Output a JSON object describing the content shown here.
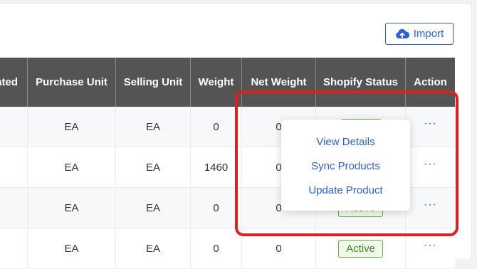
{
  "import_button": {
    "label": "Import",
    "icon": "cloud-upload-icon"
  },
  "table": {
    "headers": [
      "ated",
      "Purchase Unit",
      "Selling Unit",
      "Weight",
      "Net Weight",
      "Shopify Status",
      "Action"
    ],
    "rows": [
      {
        "purchase_unit": "EA",
        "selling_unit": "EA",
        "weight": "0",
        "net_weight": "0",
        "status": "",
        "action": "···"
      },
      {
        "purchase_unit": "EA",
        "selling_unit": "EA",
        "weight": "1460",
        "net_weight": "0",
        "status": "",
        "action": "···"
      },
      {
        "purchase_unit": "EA",
        "selling_unit": "EA",
        "weight": "0",
        "net_weight": "0",
        "status": "Active",
        "action": "···"
      },
      {
        "purchase_unit": "EA",
        "selling_unit": "EA",
        "weight": "0",
        "net_weight": "0",
        "status": "Active",
        "action": "···"
      }
    ]
  },
  "action_menu": {
    "items": [
      "View Details",
      "Sync Products",
      "Update Product"
    ]
  },
  "colors": {
    "accent": "#2f5fd0",
    "header_bg": "#545454",
    "highlight": "#e01f1f",
    "status_green": "#3d8b27"
  }
}
